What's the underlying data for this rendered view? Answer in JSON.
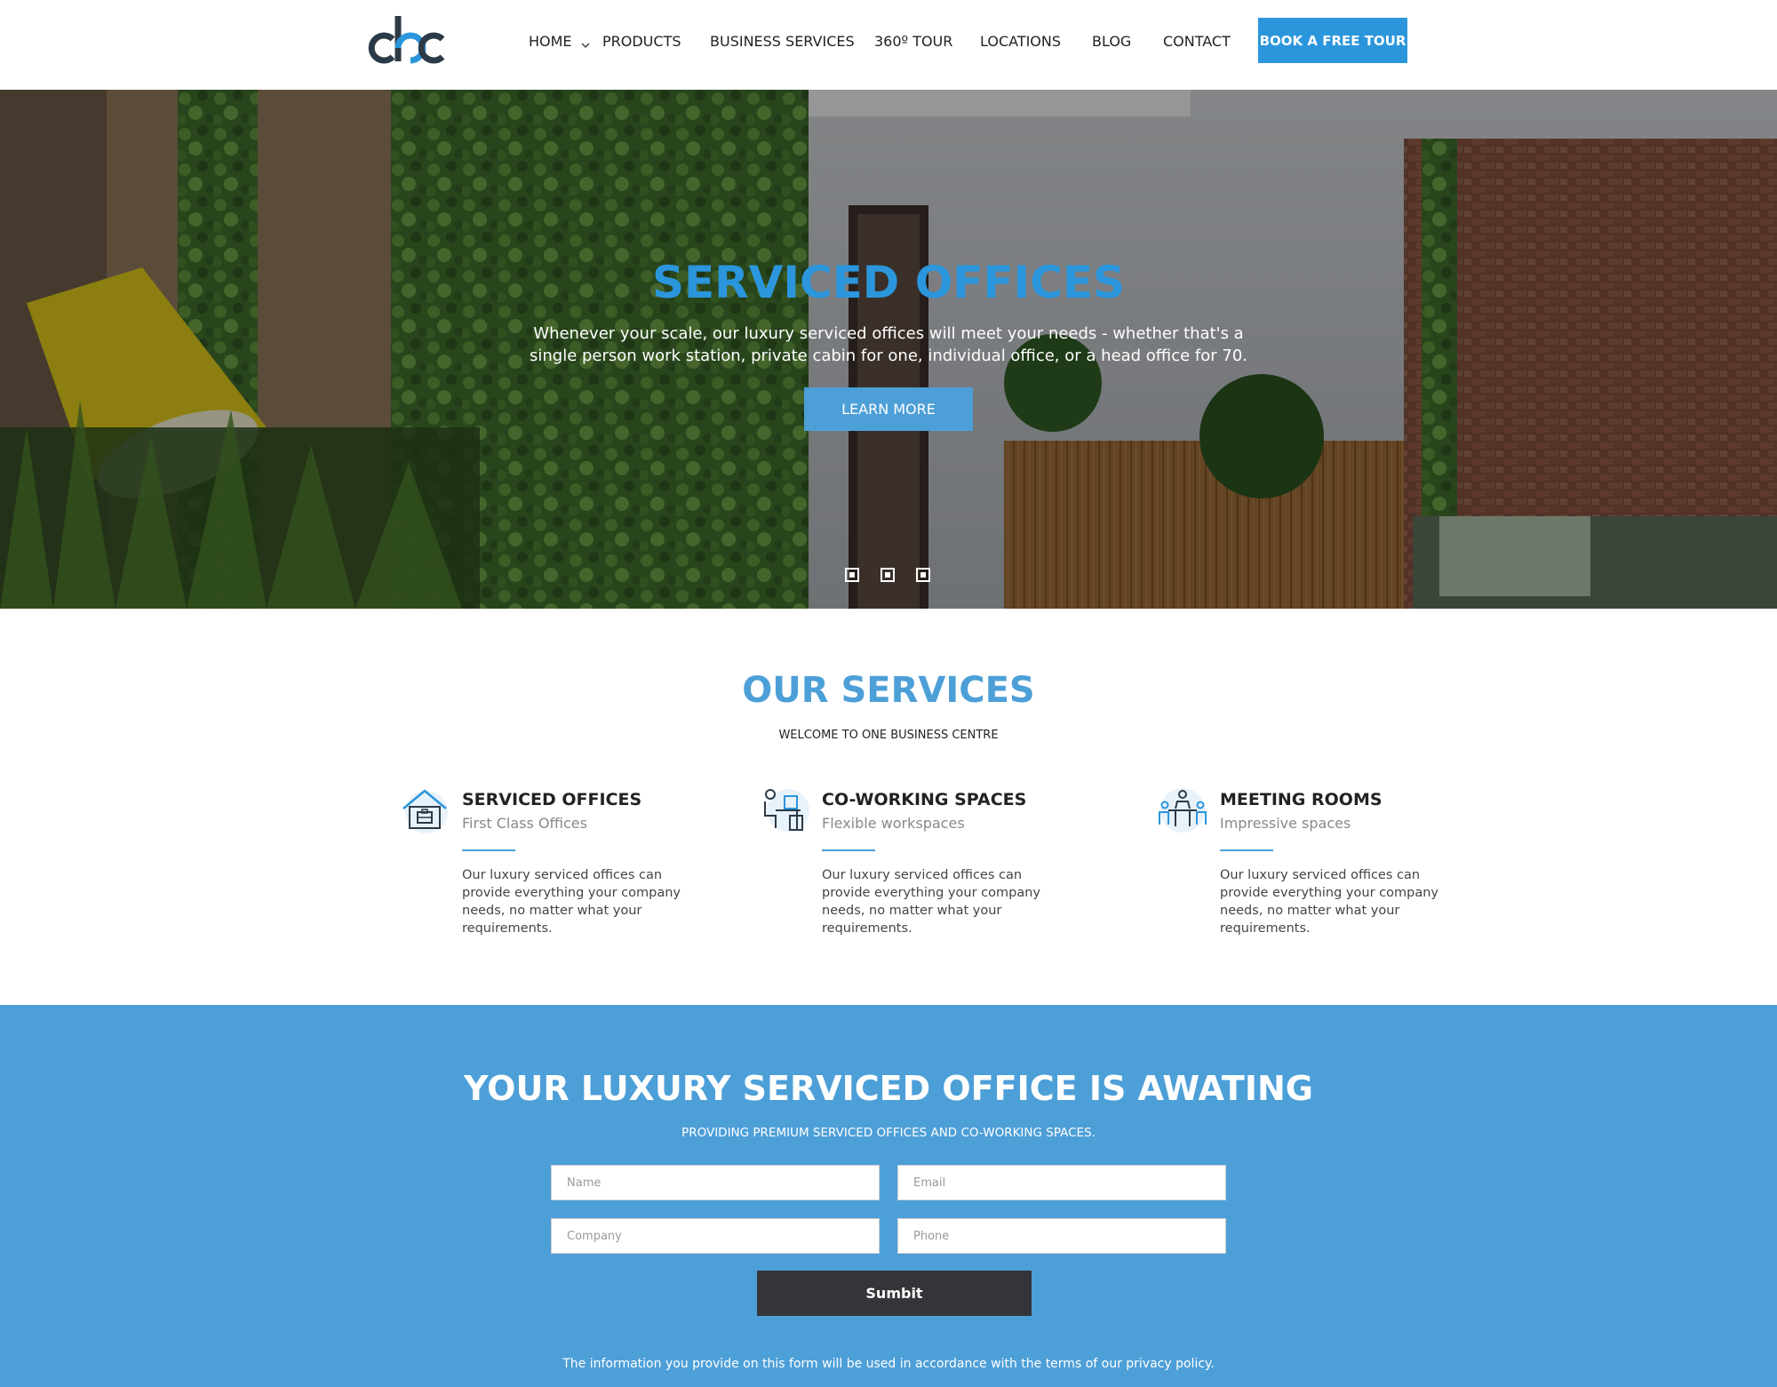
{
  "header": {
    "logo_text": "cbc",
    "nav": [
      {
        "label": "HOME"
      },
      {
        "label": "PRODUCTS"
      },
      {
        "label": "BUSINESS SERVICES"
      },
      {
        "label": "360º TOUR"
      },
      {
        "label": "LOCATIONS"
      },
      {
        "label": "BLOG"
      },
      {
        "label": "CONTACT"
      }
    ],
    "cta_label": "BOOK A FREE TOUR"
  },
  "hero": {
    "title": "SERVICED OFFICES",
    "text": "Whenever your scale, our luxury serviced offices will meet your needs - whether that's a single person work station, private cabin for one, individual office, or a head office for 70.",
    "button_label": "LEARN MORE",
    "slide_count": 3
  },
  "services": {
    "title": "OUR SERVICES",
    "subtitle": "WELCOME TO ONE BUSINESS CENTRE",
    "items": [
      {
        "title": "SERVICED OFFICES",
        "subtitle": "First Class Offices",
        "description": "Our luxury serviced offices can provide everything your company needs, no matter what your requirements.",
        "icon": "office-building-icon"
      },
      {
        "title": "CO-WORKING SPACES",
        "subtitle": "Flexible workspaces",
        "description": "Our luxury serviced offices can provide everything your company needs, no matter what your requirements.",
        "icon": "desk-worker-icon"
      },
      {
        "title": "MEETING ROOMS",
        "subtitle": "Impressive spaces",
        "description": "Our luxury serviced offices can provide everything your company needs, no matter what your requirements.",
        "icon": "meeting-icon"
      }
    ]
  },
  "contact": {
    "title": "YOUR LUXURY SERVICED OFFICE IS AWATING",
    "subtitle": "PROVIDING PREMIUM SERVICED OFFICES AND CO-WORKING SPACES.",
    "fields": {
      "name_placeholder": "Name",
      "email_placeholder": "Email",
      "company_placeholder": "Company",
      "phone_placeholder": "Phone"
    },
    "submit_label": "Sumbit",
    "privacy": "The information you provide on this form will be used in accordance with the terms of our privacy policy."
  },
  "colors": {
    "accent": "#2b96dc",
    "section_blue": "#4d9fd8",
    "dark_button": "#333538"
  }
}
